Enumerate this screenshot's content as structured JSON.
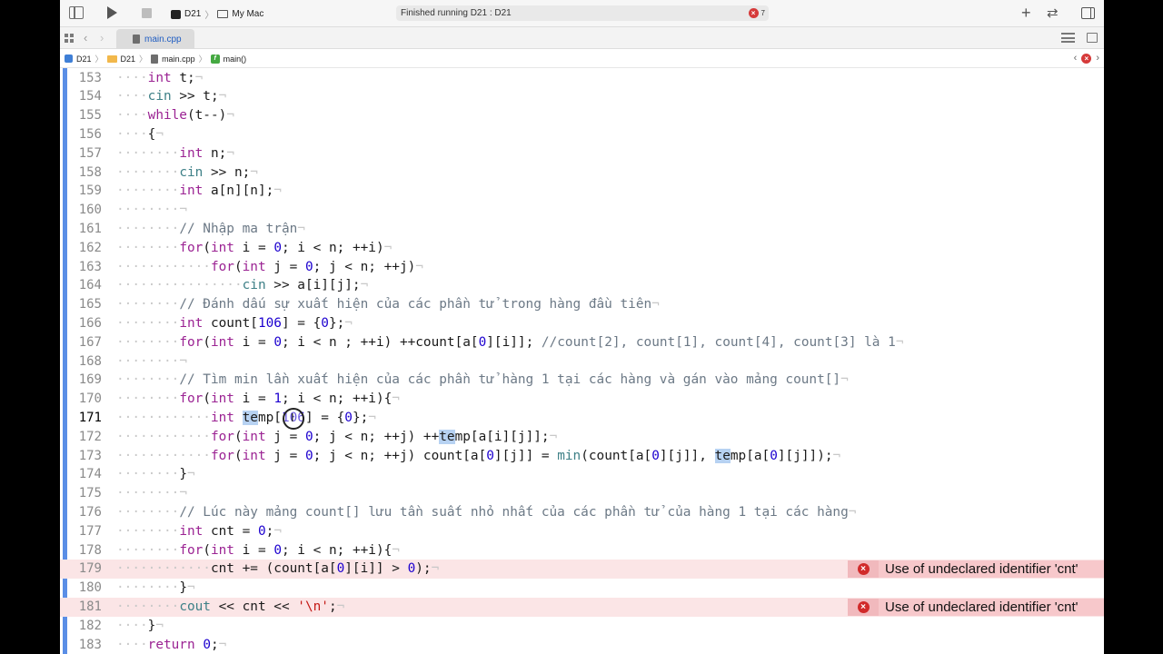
{
  "toolbar": {
    "scheme": "D21",
    "destination": "My Mac",
    "status": "Finished running D21 : D21",
    "error_count": "7"
  },
  "tabs": [
    {
      "label": "main.cpp"
    }
  ],
  "jumpbar": {
    "items": [
      "D21",
      "D21",
      "main.cpp",
      "main()"
    ],
    "nav": [
      "‹",
      "›"
    ]
  },
  "errors": {
    "line179": "Use of undeclared identifier 'cnt'",
    "line181": "Use of undeclared identifier 'cnt'"
  },
  "editor": {
    "current_line": 171,
    "lines": [
      {
        "n": "153",
        "indent": "····",
        "code": "int t;¬"
      },
      {
        "n": "154",
        "indent": "····",
        "code": "cin >> t;¬"
      },
      {
        "n": "155",
        "indent": "····",
        "code": "while(t--)¬"
      },
      {
        "n": "156",
        "indent": "····",
        "code": "{¬"
      },
      {
        "n": "157",
        "indent": "········",
        "code": "int n;¬"
      },
      {
        "n": "158",
        "indent": "········",
        "code": "cin >> n;¬"
      },
      {
        "n": "159",
        "indent": "········",
        "code": "int a[n][n];¬"
      },
      {
        "n": "160",
        "indent": "········",
        "code": "¬"
      },
      {
        "n": "161",
        "indent": "········",
        "code": "// Nhập ma trận¬"
      },
      {
        "n": "162",
        "indent": "········",
        "code": "for(int i = 0; i < n; ++i)¬"
      },
      {
        "n": "163",
        "indent": "············",
        "code": "for(int j = 0; j < n; ++j)¬"
      },
      {
        "n": "164",
        "indent": "················",
        "code": "cin >> a[i][j];¬"
      },
      {
        "n": "165",
        "indent": "········",
        "code": "// Đánh dấu sự xuất hiện của các phần tử trong hàng đầu tiên¬"
      },
      {
        "n": "166",
        "indent": "········",
        "code": "int count[106] = {0};¬"
      },
      {
        "n": "167",
        "indent": "········",
        "code": "for(int i = 0; i < n ; ++i) ++count[a[0][i]]; //count[2], count[1], count[4], count[3] là 1¬"
      },
      {
        "n": "168",
        "indent": "········",
        "code": "¬"
      },
      {
        "n": "169",
        "indent": "········",
        "code": "// Tìm min lần xuất hiện của các phần tử hàng 1 tại các hàng và gán vào mảng count[]¬"
      },
      {
        "n": "170",
        "indent": "········",
        "code": "for(int i = 1; i < n; ++i){¬"
      },
      {
        "n": "171",
        "indent": "············",
        "code": "int temp[106] = {0};¬"
      },
      {
        "n": "172",
        "indent": "············",
        "code": "for(int j = 0; j < n; ++j) ++temp[a[i][j]];¬"
      },
      {
        "n": "173",
        "indent": "············",
        "code": "for(int j = 0; j < n; ++j) count[a[0][j]] = min(count[a[0][j]], temp[a[0][j]]);¬"
      },
      {
        "n": "174",
        "indent": "········",
        "code": "}¬"
      },
      {
        "n": "175",
        "indent": "········",
        "code": "¬"
      },
      {
        "n": "176",
        "indent": "········",
        "code": "// Lúc này mảng count[] lưu tần suất nhỏ nhất của các phần tử của hàng 1 tại các hàng¬"
      },
      {
        "n": "177",
        "indent": "········",
        "code": "int cnt = 0;¬"
      },
      {
        "n": "178",
        "indent": "········",
        "code": "for(int i = 0; i < n; ++i){¬"
      },
      {
        "n": "179",
        "indent": "············",
        "code": "cnt += (count[a[0][i]] > 0);¬"
      },
      {
        "n": "180",
        "indent": "········",
        "code": "}¬"
      },
      {
        "n": "181",
        "indent": "········",
        "code": "cout << cnt << '\\n';¬"
      },
      {
        "n": "182",
        "indent": "····",
        "code": "}¬"
      },
      {
        "n": "183",
        "indent": "····",
        "code": "return 0;¬"
      }
    ]
  },
  "colors": {
    "keyword": "#9b2393",
    "number": "#1c00cf",
    "comment": "#6c7986",
    "string": "#c41a16",
    "function": "#3e8087",
    "error_line": "#fbe5e6",
    "error_badge": "#f7c8cb"
  },
  "icons": [
    "sidebar-icon",
    "play-icon",
    "stop-icon",
    "scheme-icon",
    "mac-icon",
    "error-icon",
    "plus-icon",
    "swap-icon",
    "inspector-icon",
    "grid-icon",
    "chevron-left-icon",
    "chevron-right-icon",
    "file-icon",
    "folder-icon",
    "function-icon",
    "text-cursor-icon"
  ]
}
